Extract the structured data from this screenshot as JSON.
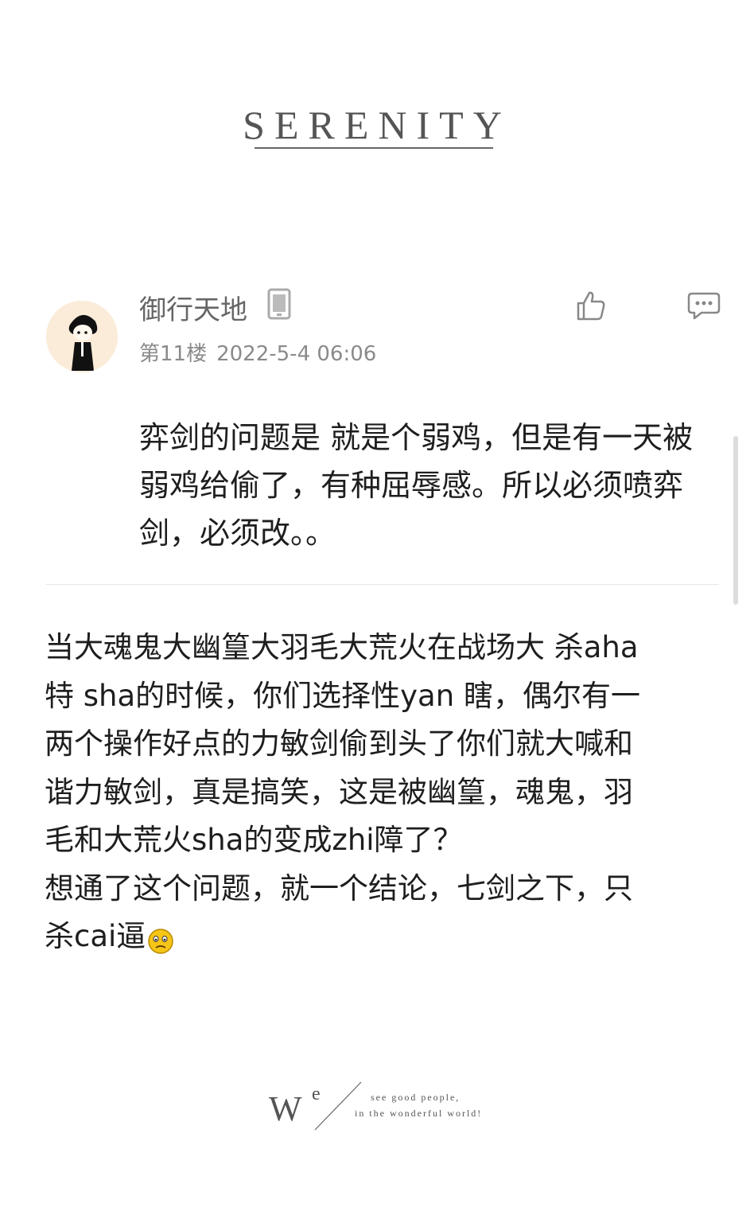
{
  "header": {
    "title": "SERENITY"
  },
  "post": {
    "username": "御行天地",
    "floor": "第11楼",
    "date": "2022-5-4 06:06",
    "reply_text": "弈剑的问题是 就是个弱鸡，但是有一天被弱鸡给偷了，有种屈辱感。所以必须喷弈剑，必须改。。",
    "icons": {
      "avatar": "avatar",
      "device": "phone-icon",
      "like": "thumbs-up-icon",
      "comment": "comment-icon",
      "emoji": "emoji-face-icon"
    }
  },
  "quote": {
    "text": "当大魂鬼大幽篁大羽毛大荒火在战场大 杀aha\n特 sha的时候，你们选择性yan 瞎，偶尔有一\n两个操作好点的力敏剑偷到头了你们就大喊和\n谐力敏剑，真是搞笑，这是被幽篁，魂鬼，羽\n毛和大荒火sha的变成zhi障了？\n想通了这个问题，就一个结论，七剑之下，只\n杀cai逼"
  },
  "footer": {
    "logo_w": "W",
    "logo_e": "e",
    "tagline_1": "see good people,",
    "tagline_2": "in the wonderful world!"
  },
  "colors": {
    "background": "#ffffff",
    "text": "#1e1e1e",
    "muted": "#8a8a8a",
    "avatar_bg": "#fbecd9"
  }
}
